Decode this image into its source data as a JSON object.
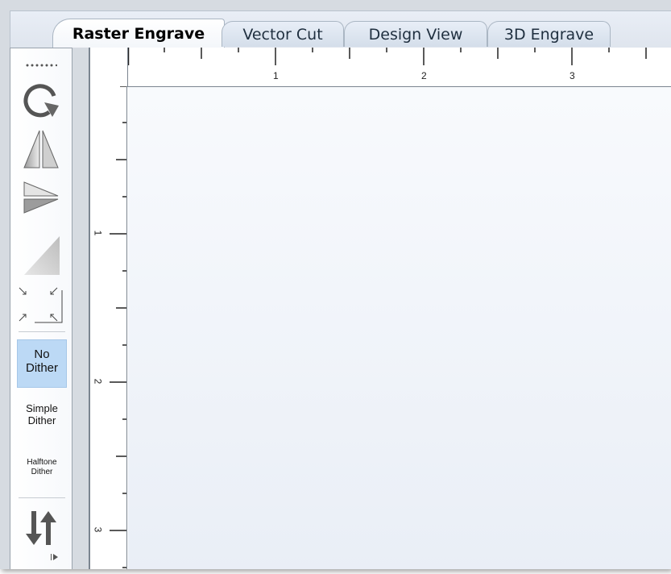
{
  "tabs": [
    {
      "label": "Raster Engrave",
      "active": true
    },
    {
      "label": "Vector Cut",
      "active": false
    },
    {
      "label": "Design View",
      "active": false
    },
    {
      "label": "3D Engrave",
      "active": false
    }
  ],
  "toolbar": {
    "tools": [
      {
        "icon": "grip-dots-icon"
      },
      {
        "icon": "rotate-icon"
      },
      {
        "icon": "mirror-horizontal-icon"
      },
      {
        "icon": "mirror-vertical-icon"
      },
      {
        "icon": "invert-icon"
      },
      {
        "icon": "resize-corners-icon"
      }
    ],
    "dither": {
      "no": {
        "line1": "No",
        "line2": "Dither"
      },
      "simple": {
        "line1": "Simple",
        "line2": "Dither"
      },
      "halftone": {
        "line1": "Halftone",
        "line2": "Dither"
      }
    },
    "bottom_icons": [
      "sort-arrows-icon",
      "expand-arrow-icon"
    ]
  },
  "rulers": {
    "top_labels": [
      "1",
      "2",
      "3"
    ],
    "left_labels": [
      "1",
      "2",
      "3"
    ]
  },
  "colors": {
    "active_dither_bg": "#bcd9f5",
    "workspace": "#eef2f8"
  }
}
